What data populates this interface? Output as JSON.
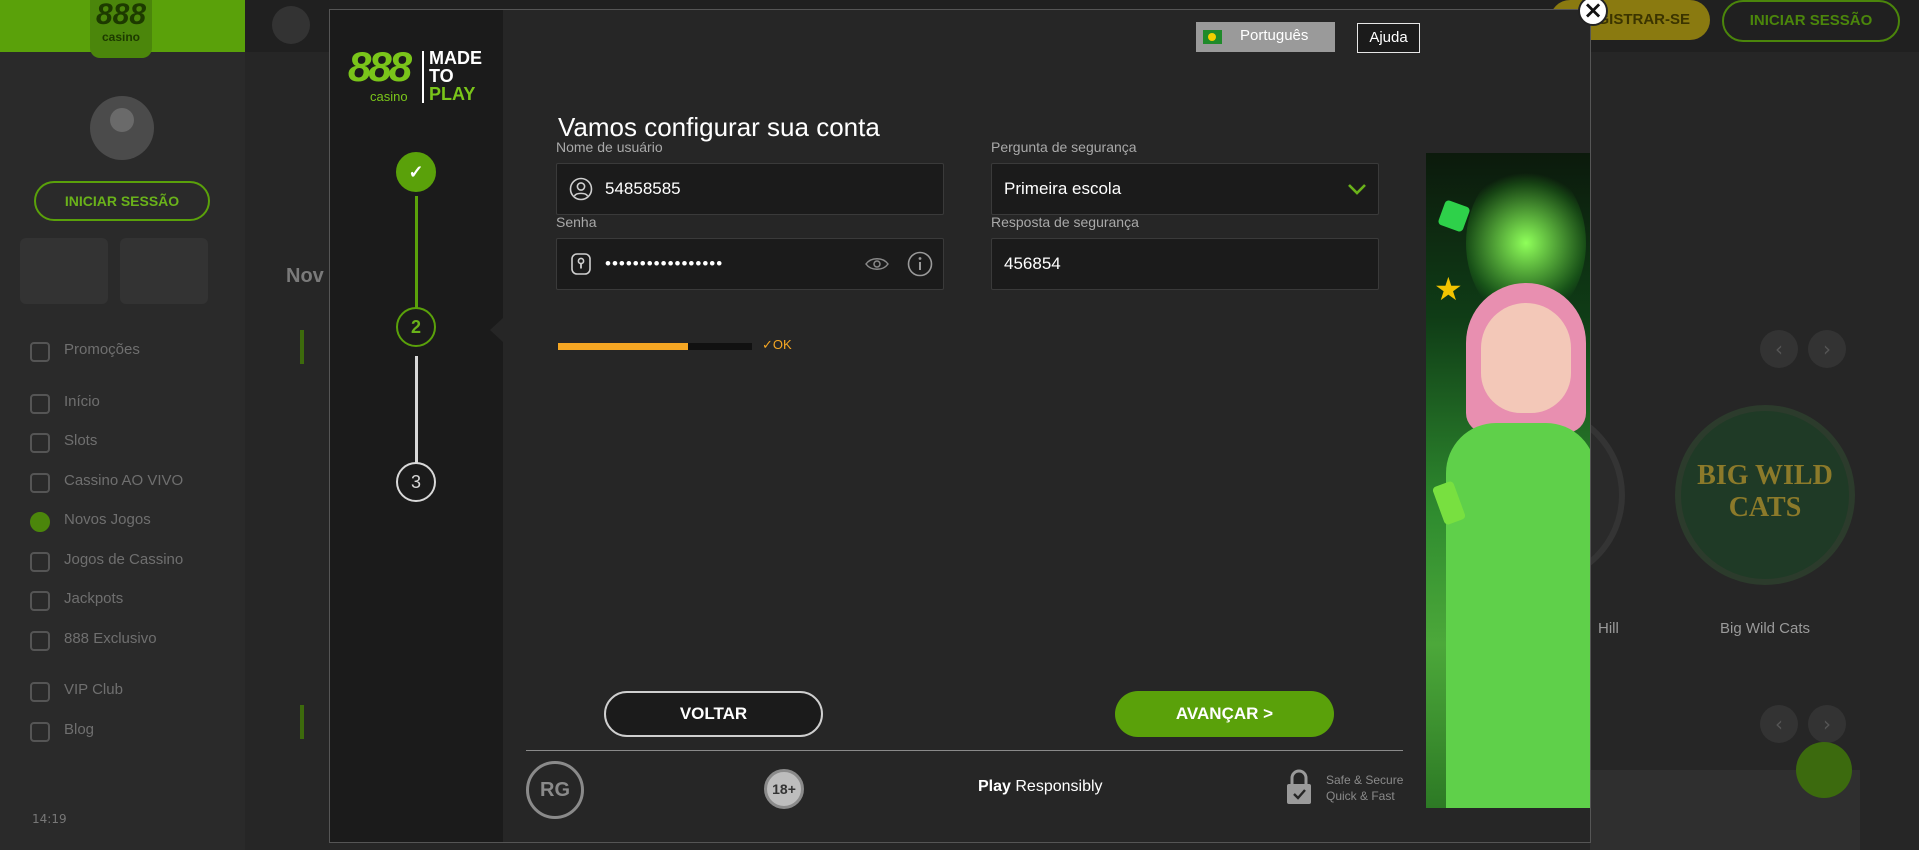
{
  "background": {
    "logo_number": "888",
    "logo_sub": "casino",
    "sidebar_login": "INICIAR SESSÃO",
    "menu": [
      "Promoções",
      "Início",
      "Slots",
      "Cassino AO VIVO",
      "Novos Jogos",
      "Jogos de Cassino",
      "Jackpots",
      "888 Exclusivo",
      "VIP Club",
      "Blog"
    ],
    "time": "14:19",
    "register_label": "REGISTRAR-SE",
    "header_login": "INICIAR SESSÃO",
    "section_title": "Nov",
    "game_title_art": "BIG WILD CATS",
    "game_label": "Big Wild Cats",
    "game2_label": "Hill"
  },
  "modal": {
    "brand": {
      "number": "888",
      "casino": "casino",
      "tagline_1": "MADE",
      "tagline_2": "TO",
      "tagline_3": "PLAY"
    },
    "steps": [
      {
        "label": "✓",
        "state": "done"
      },
      {
        "label": "2",
        "state": "current"
      },
      {
        "label": "3",
        "state": "pending"
      }
    ],
    "language": "Português",
    "help": "Ajuda",
    "title": "Vamos configurar sua conta",
    "username": {
      "label": "Nome de usuário",
      "value": "54858585"
    },
    "password": {
      "label": "Senha",
      "value": "•••••••••••••••••"
    },
    "password_strength": {
      "fraction": 0.67,
      "status": "OK"
    },
    "security_question": {
      "label": "Pergunta de segurança",
      "value": "Primeira escola"
    },
    "security_answer": {
      "label": "Resposta de segurança",
      "value": "456854"
    },
    "back_button": "VOLTAR",
    "next_button": "AVANÇAR >",
    "footer": {
      "rg_badge": "RG",
      "age_badge": "18+",
      "play_bold": "Play",
      "play_rest": " Responsibly",
      "safe_line_1": "Safe & Secure",
      "safe_line_2": "Quick & Fast"
    }
  },
  "colors": {
    "accent_green": "#5aa10a",
    "brand_green": "#7ac51a",
    "strength_orange": "#f5a623",
    "modal_bg": "#262626",
    "rail_bg": "#1b1b1b"
  }
}
